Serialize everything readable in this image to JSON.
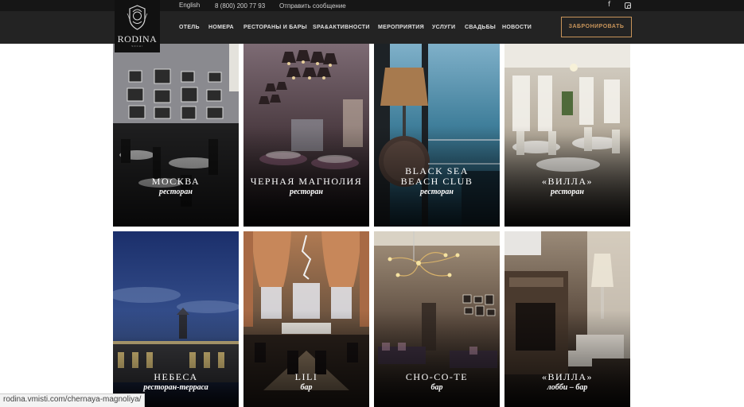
{
  "topbar": {
    "language": "English",
    "phone": "8 (800) 200 77 93",
    "message": "Отправить сообщение",
    "facebook_icon": "f"
  },
  "logo": {
    "name": "RODINA",
    "tagline": "GRAND HOTEL & SPA",
    "sub": "SOCHI"
  },
  "nav": {
    "items": [
      "ОТЕЛЬ",
      "НОМЕРА",
      "РЕСТОРАНЫ И БАРЫ",
      "SPA&АКТИВНОСТИ",
      "МЕРОПРИЯТИЯ",
      "УСЛУГИ",
      "СВАДЬБЫ",
      "НОВОСТИ"
    ],
    "book_label": "ЗАБРОНИРОВАТЬ"
  },
  "tiles": [
    {
      "title": "МОСКВА",
      "subtitle": "ресторан"
    },
    {
      "title": "ЧЕРНАЯ МАГНОЛИЯ",
      "subtitle": "ресторан"
    },
    {
      "title": "BLACK SEA BEACH CLUB",
      "subtitle": "ресторан"
    },
    {
      "title": "«ВИЛЛА»",
      "subtitle": "ресторан"
    },
    {
      "title": "НЕБЕСА",
      "subtitle": "ресторан-терраса"
    },
    {
      "title": "LILI",
      "subtitle": "бар"
    },
    {
      "title": "CHO-CO-TE",
      "subtitle": "бар"
    },
    {
      "title": "«ВИЛЛА»",
      "subtitle": "лобби – бар"
    }
  ],
  "status_bar": {
    "url": "rodina.vmisti.com/chernaya-magnoliya/"
  },
  "colors": {
    "header_bg": "#232323",
    "accent": "#c8945a"
  }
}
